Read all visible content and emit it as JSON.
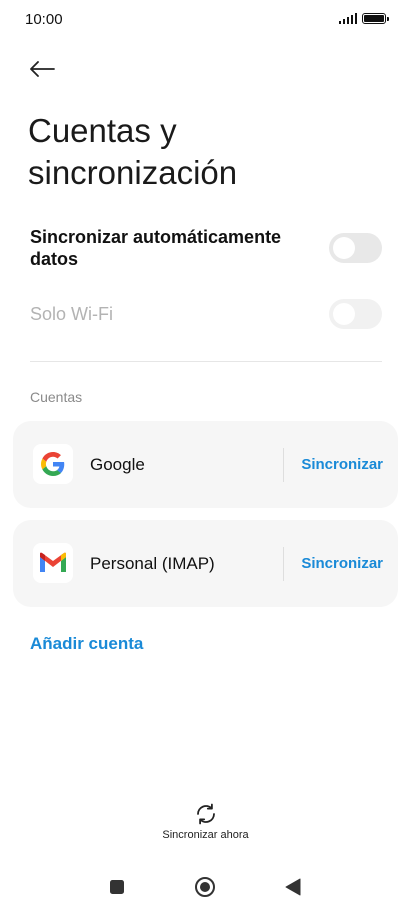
{
  "status_bar": {
    "time": "10:00"
  },
  "header": {
    "title": "Cuentas y sincronización"
  },
  "settings": {
    "auto_sync_label": "Sincronizar automáticamente datos",
    "auto_sync_enabled": false,
    "wifi_only_label": "Solo Wi-Fi",
    "wifi_only_enabled": false
  },
  "accounts_section": {
    "label": "Cuentas",
    "items": [
      {
        "name": "Google",
        "icon": "google-icon",
        "sync_label": "Sincronizar"
      },
      {
        "name": "Personal (IMAP)",
        "icon": "gmail-icon",
        "sync_label": "Sincronizar"
      }
    ]
  },
  "add_account_label": "Añadir cuenta",
  "sync_now": {
    "label": "Sincronizar ahora",
    "icon": "sync-icon"
  },
  "colors": {
    "accent": "#1a8ad7",
    "card_bg": "#f6f6f6",
    "toggle_off": "#e8e8e8"
  }
}
